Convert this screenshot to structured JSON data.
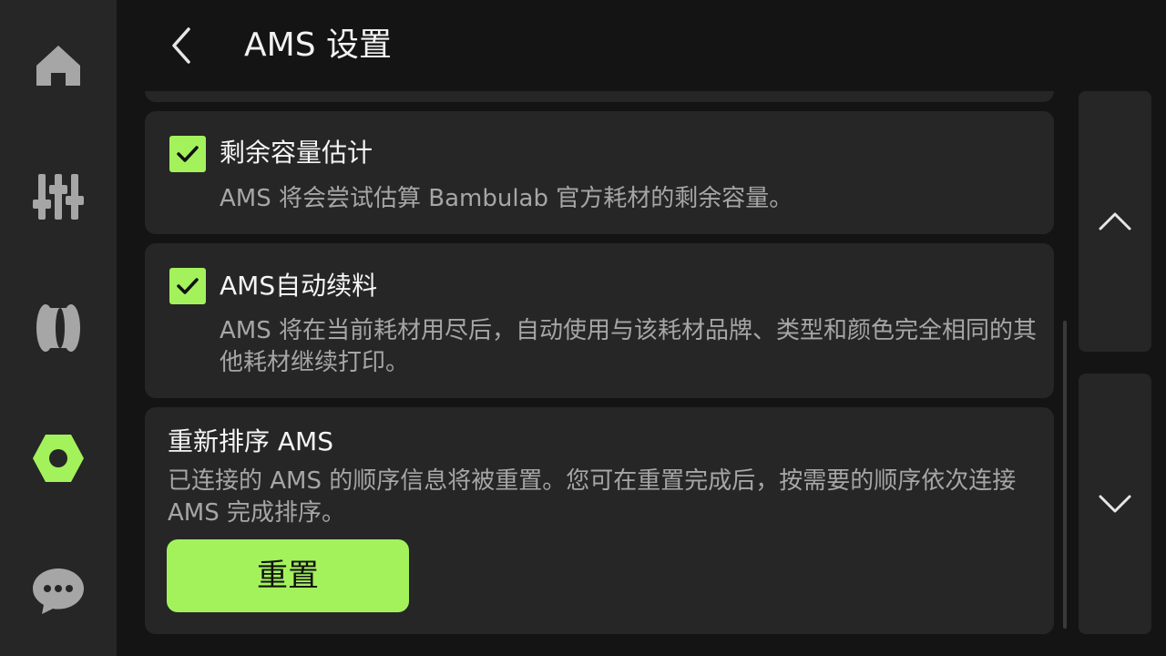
{
  "header": {
    "title": "AMS 设置"
  },
  "sidebar": {
    "items": [
      {
        "icon": "home-icon"
      },
      {
        "icon": "controls-icon"
      },
      {
        "icon": "filament-icon"
      },
      {
        "icon": "settings-hex-icon",
        "active": true
      },
      {
        "icon": "chat-icon"
      }
    ]
  },
  "options": [
    {
      "title": "剩余容量估计",
      "description": "AMS 将会尝试估算 Bambulab 官方耗材的剩余容量。",
      "checked": true
    },
    {
      "title": "AMS自动续料",
      "description": "AMS 将在当前耗材用尽后，自动使用与该耗材品牌、类型和颜色完全相同的其他耗材继续打印。",
      "checked": true
    }
  ],
  "reorder": {
    "title": "重新排序 AMS",
    "description": "已连接的 AMS 的顺序信息将被重置。您可在重置完成后，按需要的顺序依次连接 AMS 完成排序。",
    "button_label": "重置"
  },
  "colors": {
    "accent": "#a3f25c",
    "background": "#141414",
    "panel": "#262626"
  }
}
